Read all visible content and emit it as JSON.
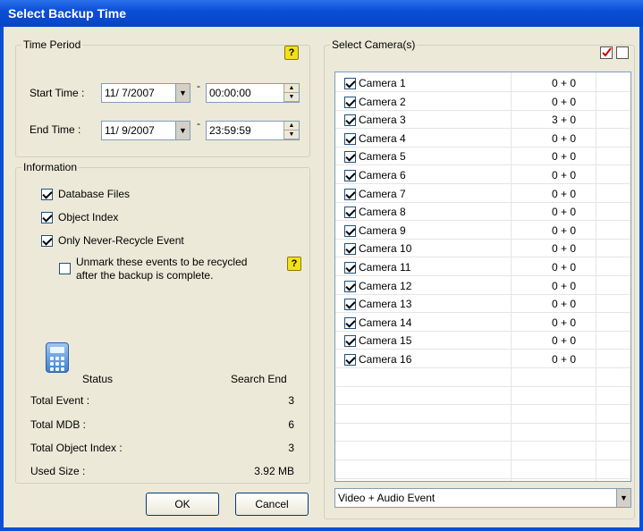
{
  "window": {
    "title": "Select Backup Time"
  },
  "time_period": {
    "legend": "Time Period",
    "start_label": "Start Time :",
    "start_date": "11/ 7/2007",
    "start_time": "00:00:00",
    "end_label": "End Time :",
    "end_date": "11/ 9/2007",
    "end_time": "23:59:59",
    "separator": "-",
    "help_glyph": "?"
  },
  "information": {
    "legend": "Information",
    "options": [
      {
        "label": "Database Files",
        "checked": true
      },
      {
        "label": "Object Index",
        "checked": true
      },
      {
        "label": "Only Never-Recycle Event",
        "checked": true
      }
    ],
    "unmark_line1": "Unmark these events to be recycled",
    "unmark_line2": "after the backup is complete.",
    "unmark_checked": false,
    "help_glyph": "?",
    "status_icon": "calculator-icon",
    "status_label": "Status",
    "status_value": "Search End",
    "stats": [
      {
        "label": "Total Event :",
        "value": "3"
      },
      {
        "label": "Total MDB :",
        "value": "6"
      },
      {
        "label": "Total Object Index :",
        "value": "3"
      },
      {
        "label": "Used Size :",
        "value": "3.92 MB"
      }
    ]
  },
  "buttons": {
    "ok": "OK",
    "cancel": "Cancel"
  },
  "cameras": {
    "legend": "Select Camera(s)",
    "items": [
      {
        "name": "Camera 1",
        "count": "0 + 0"
      },
      {
        "name": "Camera 2",
        "count": "0 + 0"
      },
      {
        "name": "Camera 3",
        "count": "3 + 0"
      },
      {
        "name": "Camera 4",
        "count": "0 + 0"
      },
      {
        "name": "Camera 5",
        "count": "0 + 0"
      },
      {
        "name": "Camera 6",
        "count": "0 + 0"
      },
      {
        "name": "Camera 7",
        "count": "0 + 0"
      },
      {
        "name": "Camera 8",
        "count": "0 + 0"
      },
      {
        "name": "Camera 9",
        "count": "0 + 0"
      },
      {
        "name": "Camera 10",
        "count": "0 + 0"
      },
      {
        "name": "Camera 11",
        "count": "0 + 0"
      },
      {
        "name": "Camera 12",
        "count": "0 + 0"
      },
      {
        "name": "Camera 13",
        "count": "0 + 0"
      },
      {
        "name": "Camera 14",
        "count": "0 + 0"
      },
      {
        "name": "Camera 15",
        "count": "0 + 0"
      },
      {
        "name": "Camera 16",
        "count": "0 + 0"
      }
    ],
    "event_filter": "Video + Audio Event"
  },
  "colors": {
    "title_bar": "#0a4fd8",
    "dialog_bg": "#ece9d8",
    "help_icon": "#f2e01a"
  }
}
